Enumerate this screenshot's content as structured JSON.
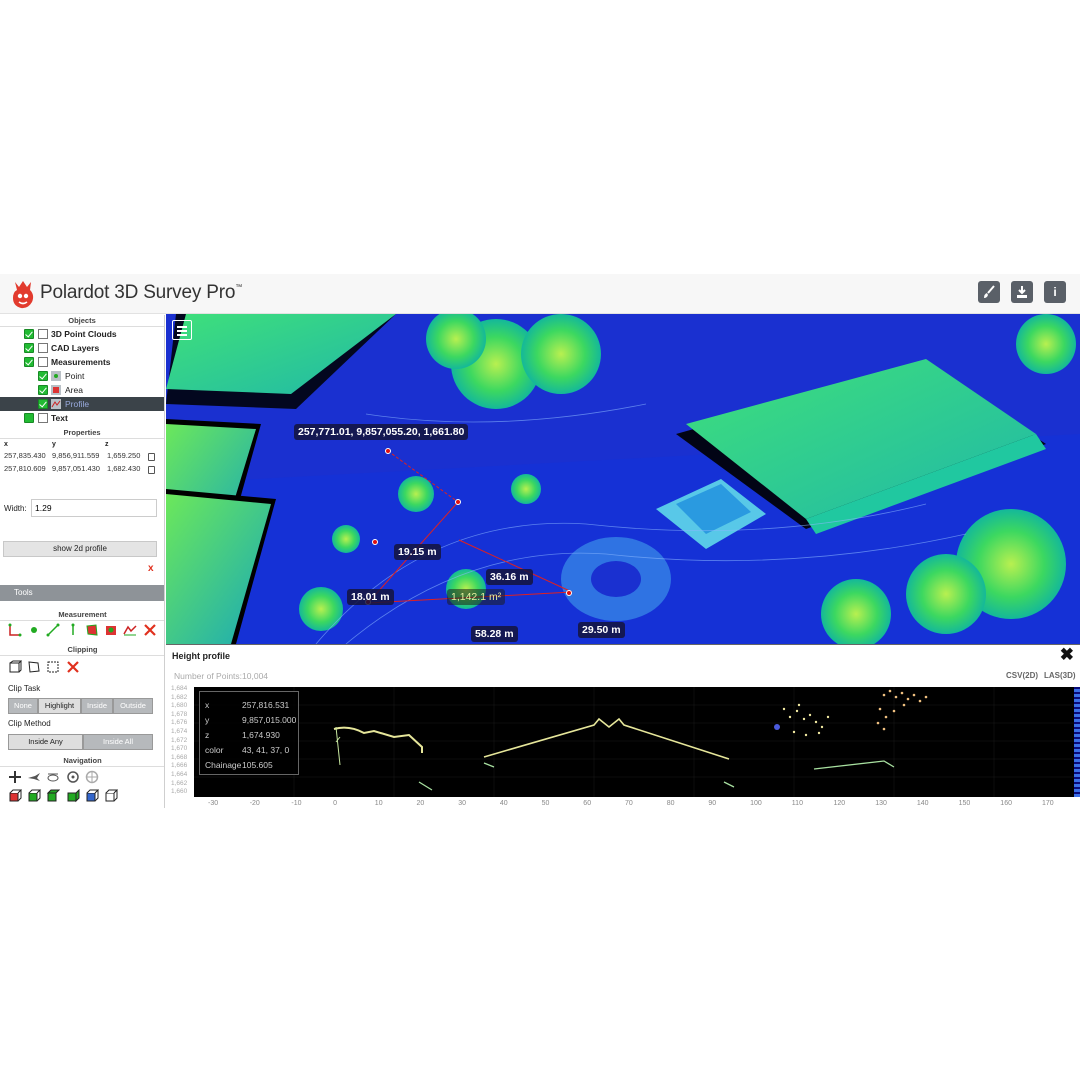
{
  "header": {
    "brand": "Polardot 3D Survey Pro",
    "brand_tm": "™",
    "colors": {
      "logo": "#e23b2e",
      "button": "#5a6068"
    },
    "buttons": [
      {
        "icon": "brush-icon"
      },
      {
        "icon": "download-icon"
      },
      {
        "icon": "info-icon",
        "label": "i"
      }
    ]
  },
  "sidebar": {
    "objects_title": "Objects",
    "tree": {
      "point_clouds": "3D Point Clouds",
      "cad_layers": "CAD Layers",
      "measurements": "Measurements",
      "point": "Point",
      "area": "Area",
      "profile": "Profile",
      "text": "Text"
    },
    "properties_title": "Properties",
    "columns": [
      "x",
      "y",
      "z"
    ],
    "rows": [
      [
        "257,835.430",
        "9,856,911.559",
        "1,659.250"
      ],
      [
        "257,810.609",
        "9,857,051.430",
        "1,682.430"
      ]
    ],
    "width_label": "Width:",
    "width_value": "1.29",
    "show_profile_label": "show 2d profile",
    "remove_label": "x",
    "tools_label": "Tools",
    "measurement_title": "Measurement",
    "clipping_title": "Clipping",
    "clip_task_label": "Clip Task",
    "clip_task_options": [
      "None",
      "Highlight",
      "Inside",
      "Outside"
    ],
    "clip_task_selected": "Highlight",
    "clip_method_label": "Clip Method",
    "clip_method_options": [
      "Inside Any",
      "Inside All"
    ],
    "clip_method_selected": "Inside Any",
    "navigation_title": "Navigation"
  },
  "viewport": {
    "coord_label": "257,771.01, 9,857,055.20, 1,661.80",
    "distances": [
      "19.15 m",
      "36.16 m",
      "18.01 m",
      "58.28 m",
      "29.50 m"
    ],
    "area_label": "1,142.1 m²"
  },
  "profile": {
    "title": "Height profile",
    "close": "✖",
    "num_points_label": "Number of Points:10,004",
    "export_csv": "CSV(2D)",
    "export_las": "LAS(3D)",
    "info": {
      "x_label": "x",
      "x": "257,816.531",
      "y_label": "y",
      "y": "9,857,015.000",
      "z_label": "z",
      "z": "1,674.930",
      "color_label": "color",
      "color": "43, 41, 37, 0",
      "chainage_label": "Chainage",
      "chainage": "105.605"
    },
    "y_ticks": [
      "1,684",
      "1,682",
      "1,680",
      "1,678",
      "1,676",
      "1,674",
      "1,672",
      "1,670",
      "1,668",
      "1,666",
      "1,664",
      "1,662",
      "1,660"
    ],
    "x_ticks": [
      "-30",
      "-20",
      "-10",
      "0",
      "10",
      "20",
      "30",
      "40",
      "50",
      "60",
      "70",
      "80",
      "90",
      "100",
      "110",
      "120",
      "130",
      "140",
      "150",
      "160",
      "170"
    ]
  }
}
